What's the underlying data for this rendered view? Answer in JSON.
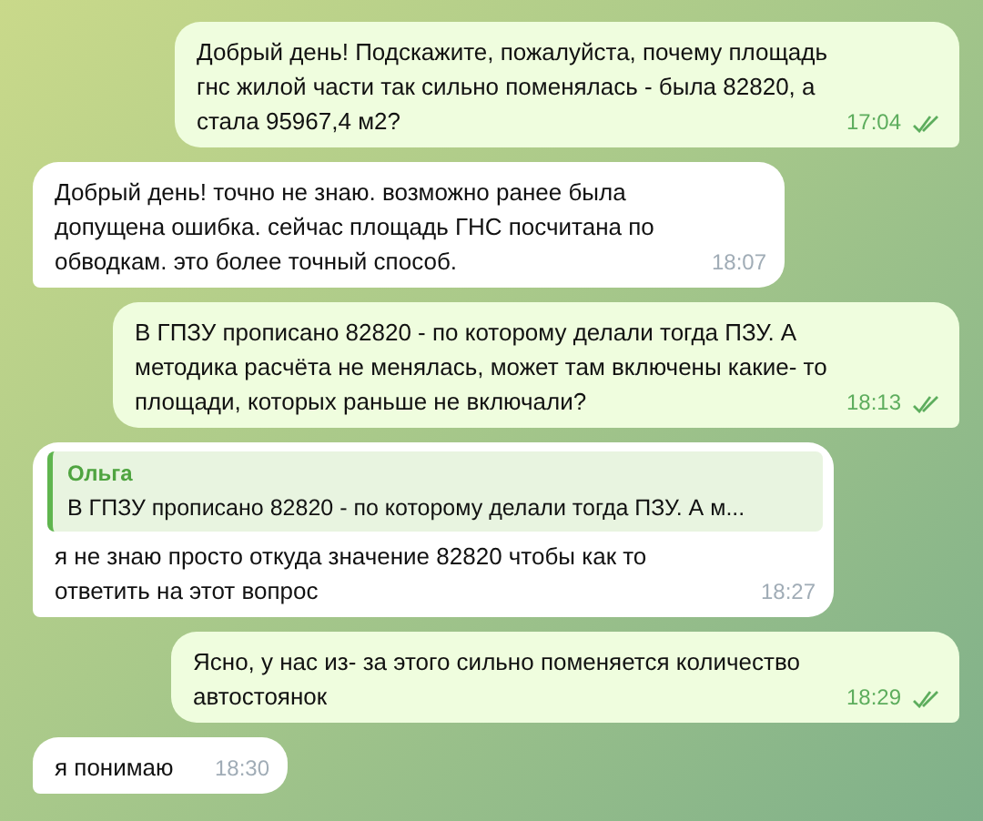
{
  "messages": [
    {
      "kind": "out",
      "text": "Добрый день! Подскажите, пожалуйста, почему площадь гнс жилой части так сильно поменялась - была 82820, а стала 95967,4 м2?",
      "time": "17:04",
      "read": true
    },
    {
      "kind": "in",
      "text": "Добрый день! точно не знаю. возможно ранее была допущена ошибка. сейчас площадь ГНС посчитана по обводкам. это более точный способ.",
      "time": "18:07"
    },
    {
      "kind": "out",
      "text": "В ГПЗУ прописано 82820 - по которому делали тогда ПЗУ. А методика расчёта не менялась, может там включены какие- то площади, которых раньше не включали?",
      "time": "18:13",
      "read": true
    },
    {
      "kind": "in",
      "reply": {
        "author": "Ольга",
        "text": "В ГПЗУ прописано 82820 - по которому делали тогда ПЗУ. А м..."
      },
      "text": "я не знаю просто откуда значение 82820 чтобы как то ответить на этот вопрос",
      "time": "18:27"
    },
    {
      "kind": "out",
      "text": "Ясно, у нас из- за этого сильно поменяется количество автостоянок",
      "time": "18:29",
      "read": true
    },
    {
      "kind": "in",
      "text": "я понимаю",
      "time": "18:30"
    }
  ]
}
